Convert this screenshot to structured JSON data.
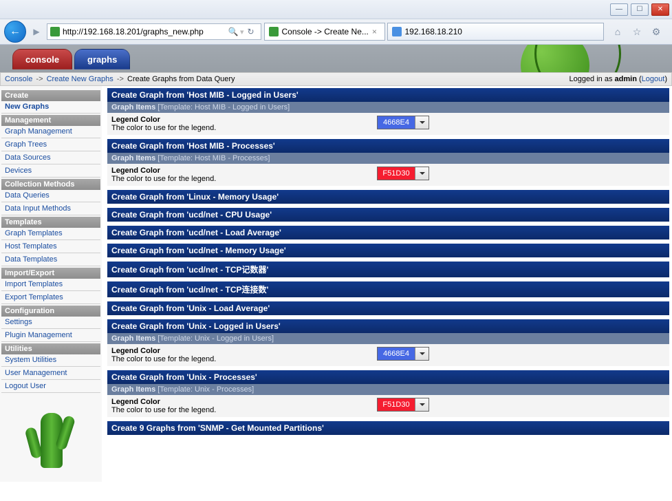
{
  "browser": {
    "url": "http://192.168.18.201/graphs_new.php",
    "tab1_title": "Console -> Create Ne...",
    "tab2_title": "192.168.18.210"
  },
  "apptabs": {
    "console": "console",
    "graphs": "graphs"
  },
  "breadcrumb": {
    "console": "Console",
    "create_new": "Create New Graphs",
    "tail": "Create Graphs from Data Query",
    "logged_prefix": "Logged in as ",
    "username": "admin",
    "logout": "Logout"
  },
  "sidebar": {
    "headers": {
      "create": "Create",
      "management": "Management",
      "collection": "Collection Methods",
      "templates": "Templates",
      "ie": "Import/Export",
      "config": "Configuration",
      "util": "Utilities"
    },
    "links": {
      "new_graphs": "New Graphs",
      "graph_mgmt": "Graph Management",
      "graph_trees": "Graph Trees",
      "data_sources": "Data Sources",
      "devices": "Devices",
      "data_queries": "Data Queries",
      "data_input": "Data Input Methods",
      "graph_tpl": "Graph Templates",
      "host_tpl": "Host Templates",
      "data_tpl": "Data Templates",
      "import_tpl": "Import Templates",
      "export_tpl": "Export Templates",
      "settings": "Settings",
      "plugin_mgmt": "Plugin Management",
      "sys_util": "System Utilities",
      "user_mgmt": "User Management",
      "logout_user": "Logout User"
    }
  },
  "labels": {
    "graph_items": "Graph Items",
    "template_prefix": "[Template: ",
    "template_suffix": "]",
    "legend_color": "Legend Color",
    "legend_desc": "The color to use for the legend."
  },
  "sections": [
    {
      "title": "Create Graph from 'Host MIB - Logged in Users'",
      "template": "Host MIB - Logged in Users",
      "color": "4668E4",
      "hex": "#4668E4",
      "textclass": ""
    },
    {
      "title": "Create Graph from 'Host MIB - Processes'",
      "template": "Host MIB - Processes",
      "color": "F51D30",
      "hex": "#F51D30",
      "textclass": ""
    },
    {
      "title": "Create Graph from 'Linux - Memory Usage'"
    },
    {
      "title": "Create Graph from 'ucd/net - CPU Usage'"
    },
    {
      "title": "Create Graph from 'ucd/net - Load Average'"
    },
    {
      "title": "Create Graph from 'ucd/net - Memory Usage'"
    },
    {
      "title": "Create Graph from 'ucd/net - TCP记数器'"
    },
    {
      "title": "Create Graph from 'ucd/net - TCP连接数'"
    },
    {
      "title": "Create Graph from 'Unix - Load Average'"
    },
    {
      "title": "Create Graph from 'Unix - Logged in Users'",
      "template": "Unix - Logged in Users",
      "color": "4668E4",
      "hex": "#4668E4",
      "textclass": ""
    },
    {
      "title": "Create Graph from 'Unix - Processes'",
      "template": "Unix - Processes",
      "color": "F51D30",
      "hex": "#F51D30",
      "textclass": ""
    },
    {
      "title": "Create 9 Graphs from 'SNMP - Get Mounted Partitions'"
    }
  ]
}
